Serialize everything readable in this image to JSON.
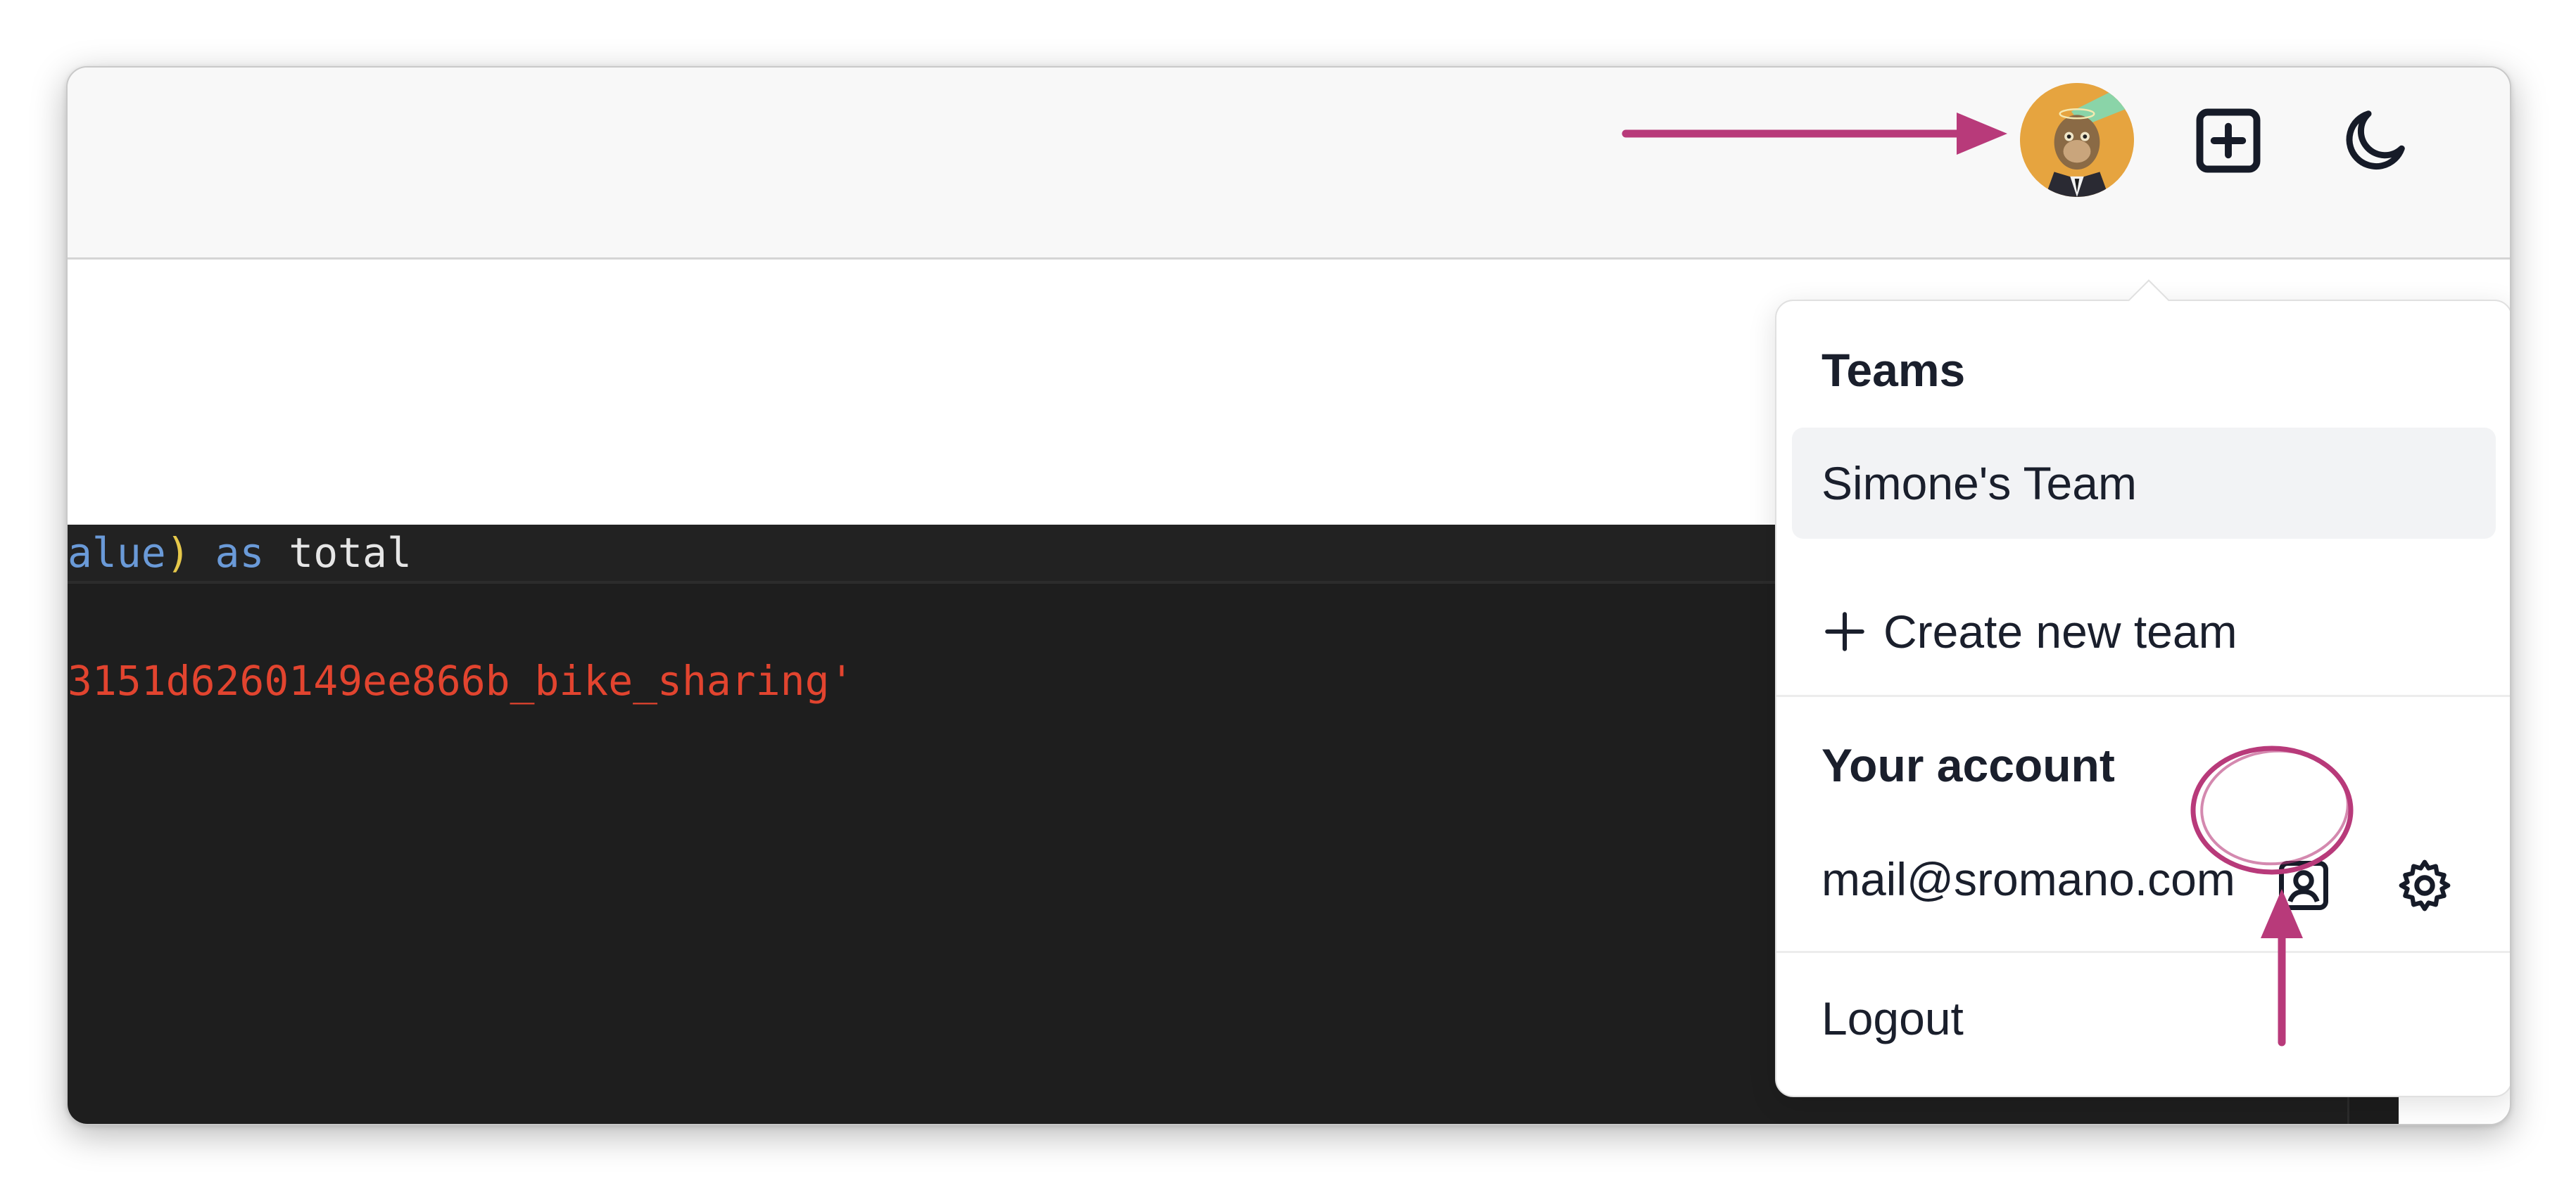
{
  "editor": {
    "line1": {
      "ident": "alue",
      "paren": ")",
      "kw": " as ",
      "plain": "total"
    },
    "line2": "3151d6260149ee866b_bike_sharing'"
  },
  "toolbar": {
    "avatar_icon": "user-avatar",
    "new_icon": "plus-square-icon",
    "theme_icon": "moon-icon"
  },
  "menu": {
    "teams_heading": "Teams",
    "teams": [
      {
        "label": "Simone's Team"
      }
    ],
    "create_team_label": "Create new team",
    "account_heading": "Your account",
    "email": "mail@sromano.com",
    "account_icon": "user-square-icon",
    "settings_icon": "gear-icon",
    "logout_label": "Logout"
  },
  "colors": {
    "annotation": "#b83a7a",
    "editor_bg": "#1e1e1e",
    "string": "#e2442f",
    "keyword": "#6a9ad8"
  }
}
